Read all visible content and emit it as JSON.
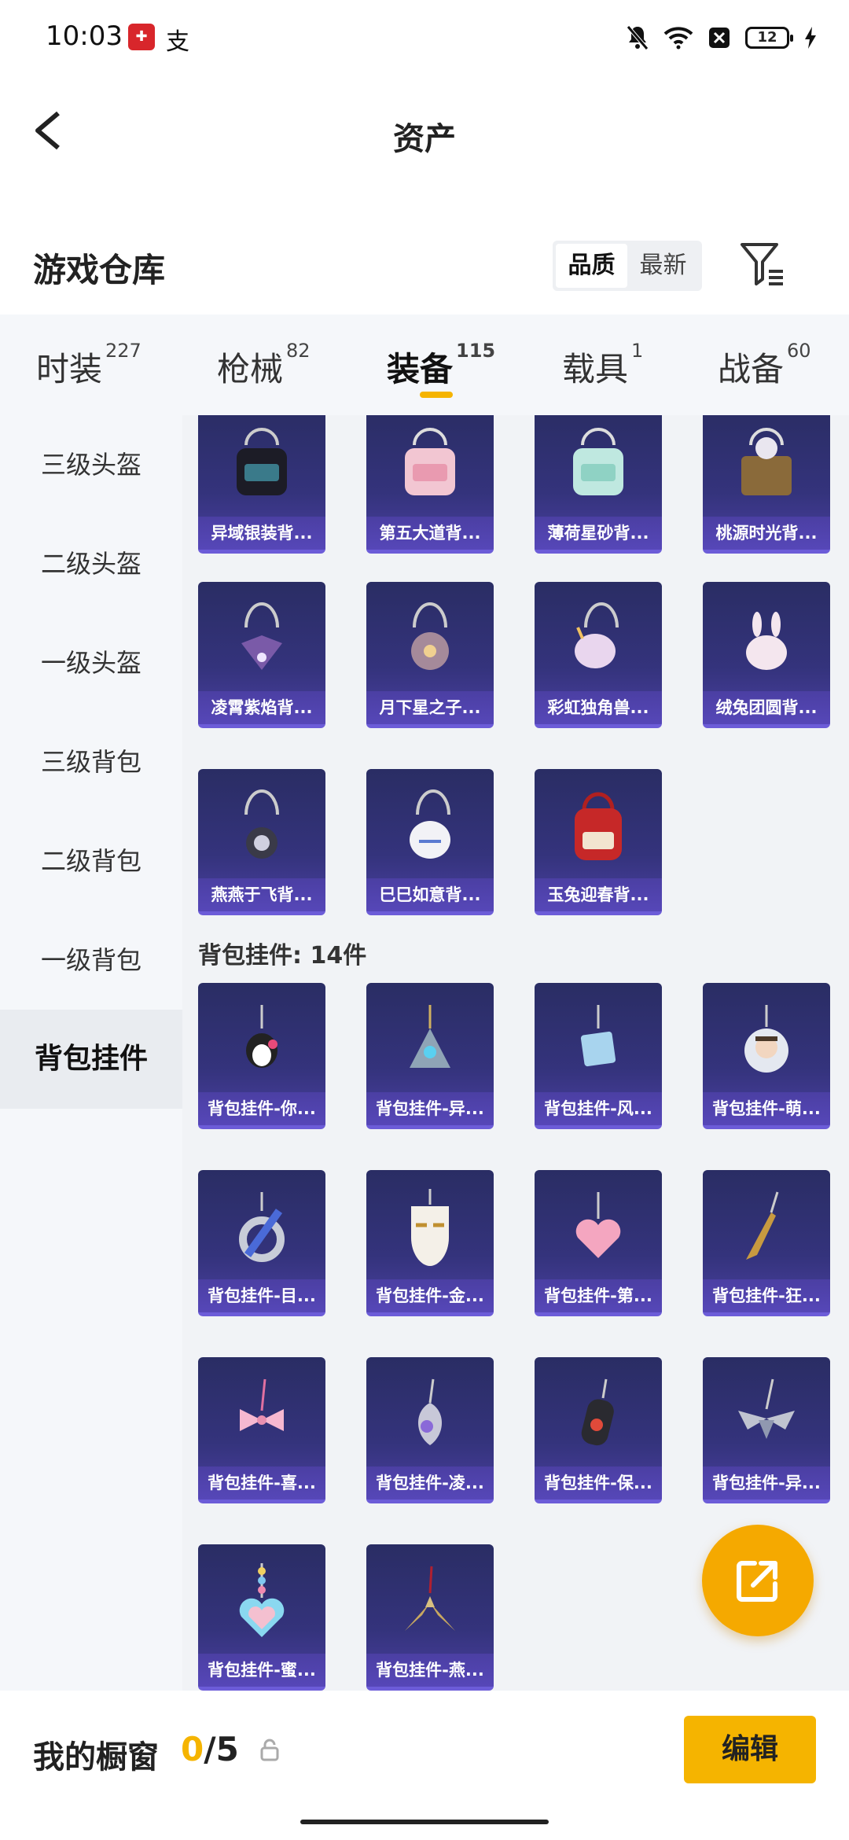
{
  "status_bar": {
    "time": "10:03",
    "app2_glyph": "支",
    "battery": "12"
  },
  "nav": {
    "title": "资产"
  },
  "warehouse": {
    "title": "游戏仓库",
    "sort_options": [
      "品质",
      "最新"
    ],
    "active_sort": "品质"
  },
  "tabs": [
    {
      "label": "时装",
      "count": "227"
    },
    {
      "label": "枪械",
      "count": "82"
    },
    {
      "label": "装备",
      "count": "115"
    },
    {
      "label": "载具",
      "count": "1"
    },
    {
      "label": "战备",
      "count": "60"
    }
  ],
  "active_tab": "装备",
  "sidebar": {
    "items": [
      "三级头盔",
      "二级头盔",
      "一级头盔",
      "三级背包",
      "二级背包",
      "一级背包",
      "背包挂件"
    ],
    "active": "背包挂件"
  },
  "backpacks": [
    "异域银装背...",
    "第五大道背...",
    "薄荷星砂背...",
    "桃源时光背...",
    "凌霄紫焰背...",
    "月下星之子...",
    "彩虹独角兽...",
    "绒兔团圆背...",
    "燕燕于飞背...",
    "巳巳如意背...",
    "玉兔迎春背..."
  ],
  "section_title": "背包挂件: 14件",
  "pendants": [
    "背包挂件-你...",
    "背包挂件-异...",
    "背包挂件-风...",
    "背包挂件-萌...",
    "背包挂件-目...",
    "背包挂件-金...",
    "背包挂件-第...",
    "背包挂件-狂...",
    "背包挂件-喜...",
    "背包挂件-凌...",
    "背包挂件-保...",
    "背包挂件-异...",
    "背包挂件-蜜...",
    "背包挂件-燕..."
  ],
  "showcase": {
    "label": "我的橱窗",
    "current": "0",
    "total": "/5",
    "edit_label": "编辑"
  },
  "colors": {
    "accent": "#f5b400",
    "card_bg": "#2f3170",
    "card_border": "#6c5cd8"
  }
}
